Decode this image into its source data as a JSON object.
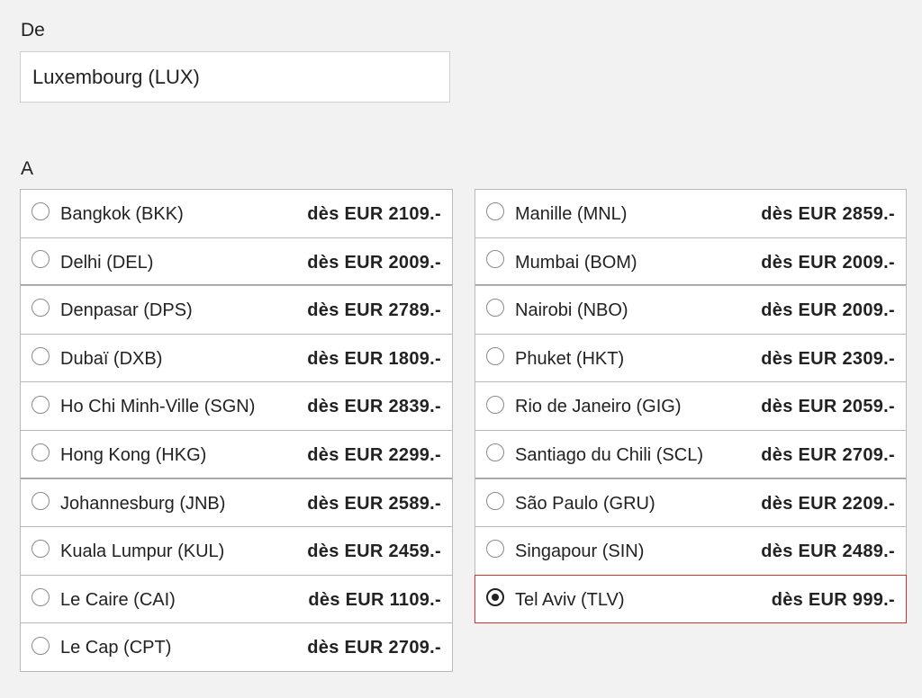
{
  "from": {
    "label": "De",
    "value": "Luxembourg (LUX)"
  },
  "to": {
    "label": "A",
    "left": [
      {
        "city": "Bangkok (BKK)",
        "price": "dès EUR 2109.-",
        "selected": false
      },
      {
        "city": "Delhi (DEL)",
        "price": "dès EUR 2009.-",
        "selected": false
      },
      {
        "city": "Denpasar (DPS)",
        "price": "dès EUR 2789.-",
        "selected": false
      },
      {
        "city": "Dubaï (DXB)",
        "price": "dès EUR 1809.-",
        "selected": false
      },
      {
        "city": "Ho Chi Minh-Ville (SGN)",
        "price": "dès EUR 2839.-",
        "selected": false
      },
      {
        "city": "Hong Kong (HKG)",
        "price": "dès EUR 2299.-",
        "selected": false
      },
      {
        "city": "Johannesburg (JNB)",
        "price": "dès EUR 2589.-",
        "selected": false
      },
      {
        "city": "Kuala Lumpur (KUL)",
        "price": "dès EUR 2459.-",
        "selected": false
      },
      {
        "city": "Le Caire (CAI)",
        "price": "dès EUR 1109.-",
        "selected": false
      },
      {
        "city": "Le Cap (CPT)",
        "price": "dès EUR 2709.-",
        "selected": false
      }
    ],
    "right": [
      {
        "city": "Manille (MNL)",
        "price": "dès EUR 2859.-",
        "selected": false
      },
      {
        "city": "Mumbai (BOM)",
        "price": "dès EUR 2009.-",
        "selected": false
      },
      {
        "city": "Nairobi (NBO)",
        "price": "dès EUR 2009.-",
        "selected": false
      },
      {
        "city": "Phuket (HKT)",
        "price": "dès EUR 2309.-",
        "selected": false
      },
      {
        "city": "Rio de Janeiro (GIG)",
        "price": "dès EUR 2059.-",
        "selected": false
      },
      {
        "city": "Santiago du Chili (SCL)",
        "price": "dès EUR 2709.-",
        "selected": false
      },
      {
        "city": "São Paulo (GRU)",
        "price": "dès EUR 2209.-",
        "selected": false
      },
      {
        "city": "Singapour (SIN)",
        "price": "dès EUR 2489.-",
        "selected": false
      },
      {
        "city": "Tel Aviv (TLV)",
        "price": "dès EUR 999.-",
        "selected": true
      }
    ]
  },
  "colors": {
    "background": "#f2f2f2",
    "selected_border": "#d0342c",
    "text": "#222222"
  }
}
